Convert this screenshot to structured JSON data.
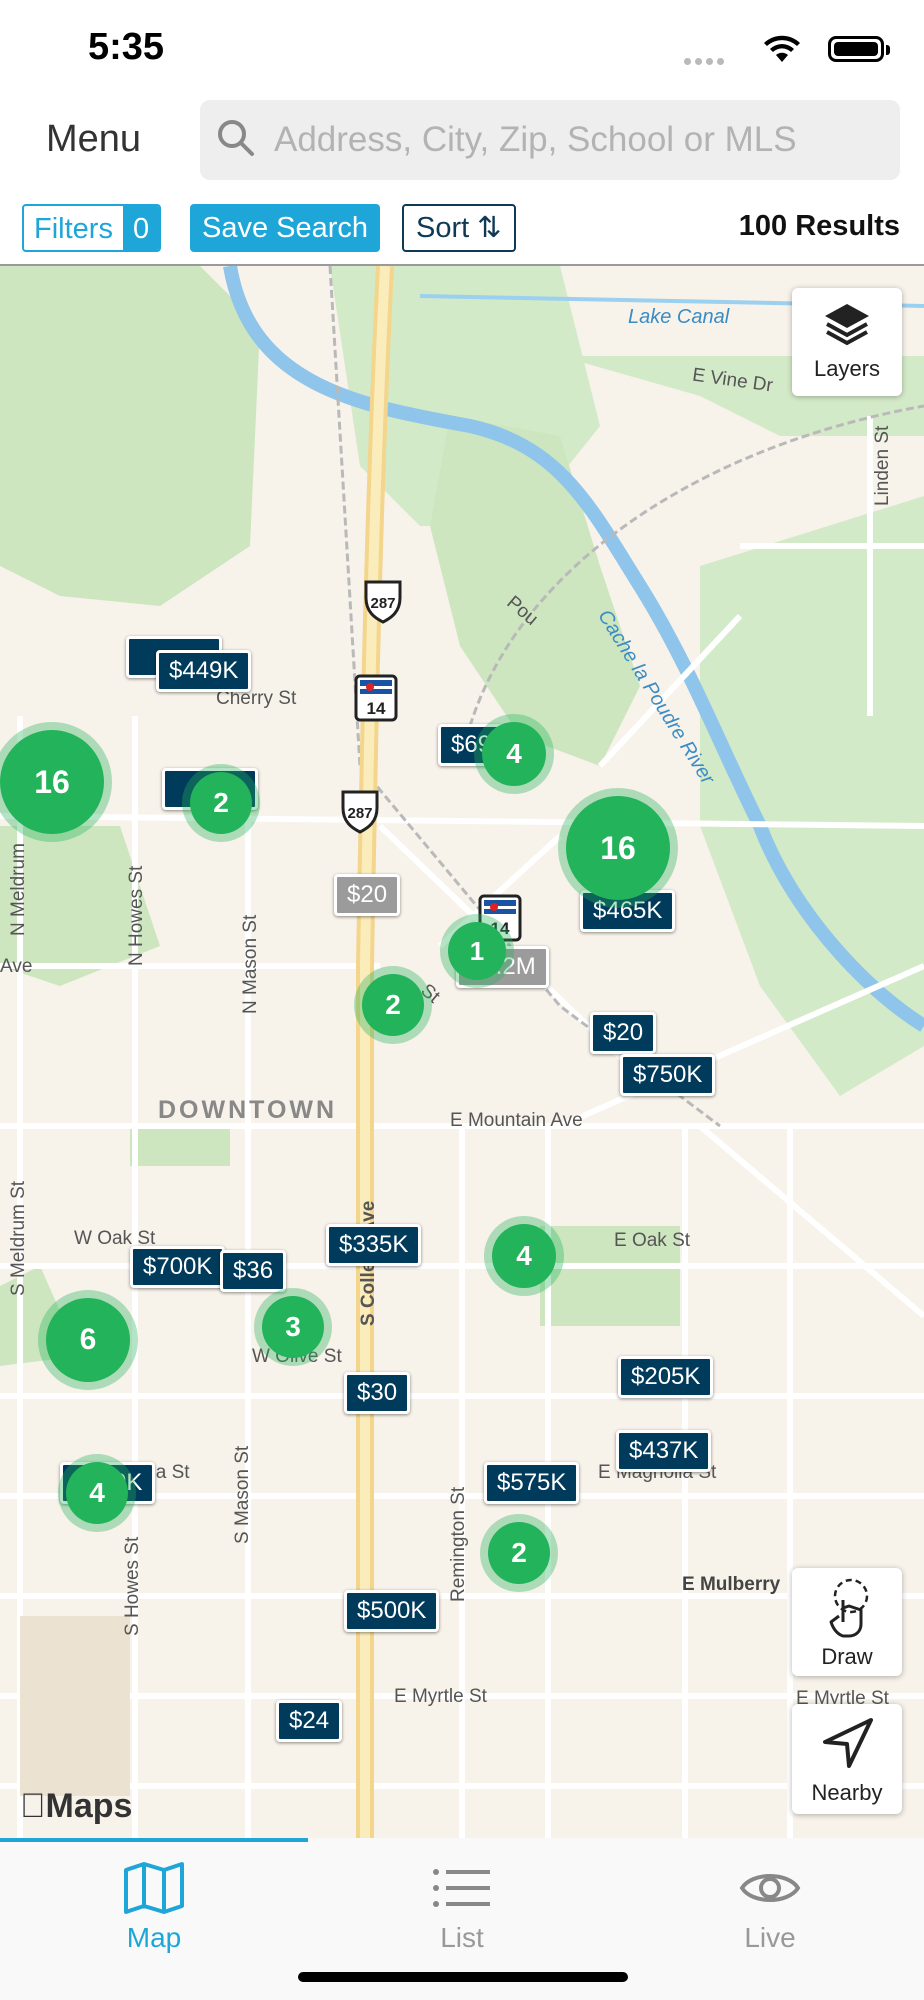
{
  "status_bar": {
    "time": "5:35"
  },
  "header": {
    "menu_label": "Menu",
    "search_placeholder": "Address, City, Zip, School or MLS"
  },
  "toolbar": {
    "filters_label": "Filters",
    "filters_count": "0",
    "save_search_label": "Save Search",
    "sort_label": "Sort",
    "results_text": "100 Results"
  },
  "map": {
    "layers_label": "Layers",
    "draw_label": "Draw",
    "nearby_label": "Nearby",
    "attribution": "Maps",
    "area_label": "DOWNTOWN",
    "streets": {
      "lake_canal": "Lake Canal",
      "e_vine": "E Vine Dr",
      "linden": "Linden St",
      "cache_la_poudre": "Cache la Poudre River",
      "cherry": "Cherry St",
      "n_meldrum": "N Meldrum",
      "n_howes": "N Howes St",
      "n_mason": "N Mason St",
      "ave": "Ave",
      "e_mountain": "E Mountain Ave",
      "s_college": "S College Ave",
      "w_oak": "W Oak St",
      "e_oak": "E Oak St",
      "w_olive": "W Olive St",
      "s_meldrum": "S Meldrum St",
      "w_magnolia": "W Magnolia St",
      "e_magnolia": "E Magnolia St",
      "s_mason": "S Mason St",
      "s_howes": "S Howes St",
      "remington": "Remington St",
      "e_mulberry": "E Mulberry",
      "e_myrtle": "E Myrtle St",
      "e_myrtle_2": "E Myrtle St",
      "pou": "Pou",
      "st": "St"
    },
    "route_shields": [
      "287",
      "14",
      "287",
      "14"
    ],
    "price_pins": [
      "$449K",
      "$69",
      "$465K",
      "$20",
      "$1.2M",
      "$20",
      "$750K",
      "$335K",
      "$700K",
      "$36",
      "$30",
      "$205K",
      "$437K",
      "$450K",
      "$575K",
      "$500K",
      "$24"
    ],
    "clusters": [
      "16",
      "2",
      "4",
      "16",
      "2",
      "4",
      "6",
      "3",
      "4",
      "2",
      "1"
    ]
  },
  "tabs": [
    {
      "label": "Map",
      "color": "#1ea6d8"
    },
    {
      "label": "List",
      "color": "#999999"
    },
    {
      "label": "Live",
      "color": "#999999"
    }
  ],
  "colors": {
    "accent": "#1ea6d8",
    "pin": "#003b5c",
    "cluster": "#23b35a"
  }
}
